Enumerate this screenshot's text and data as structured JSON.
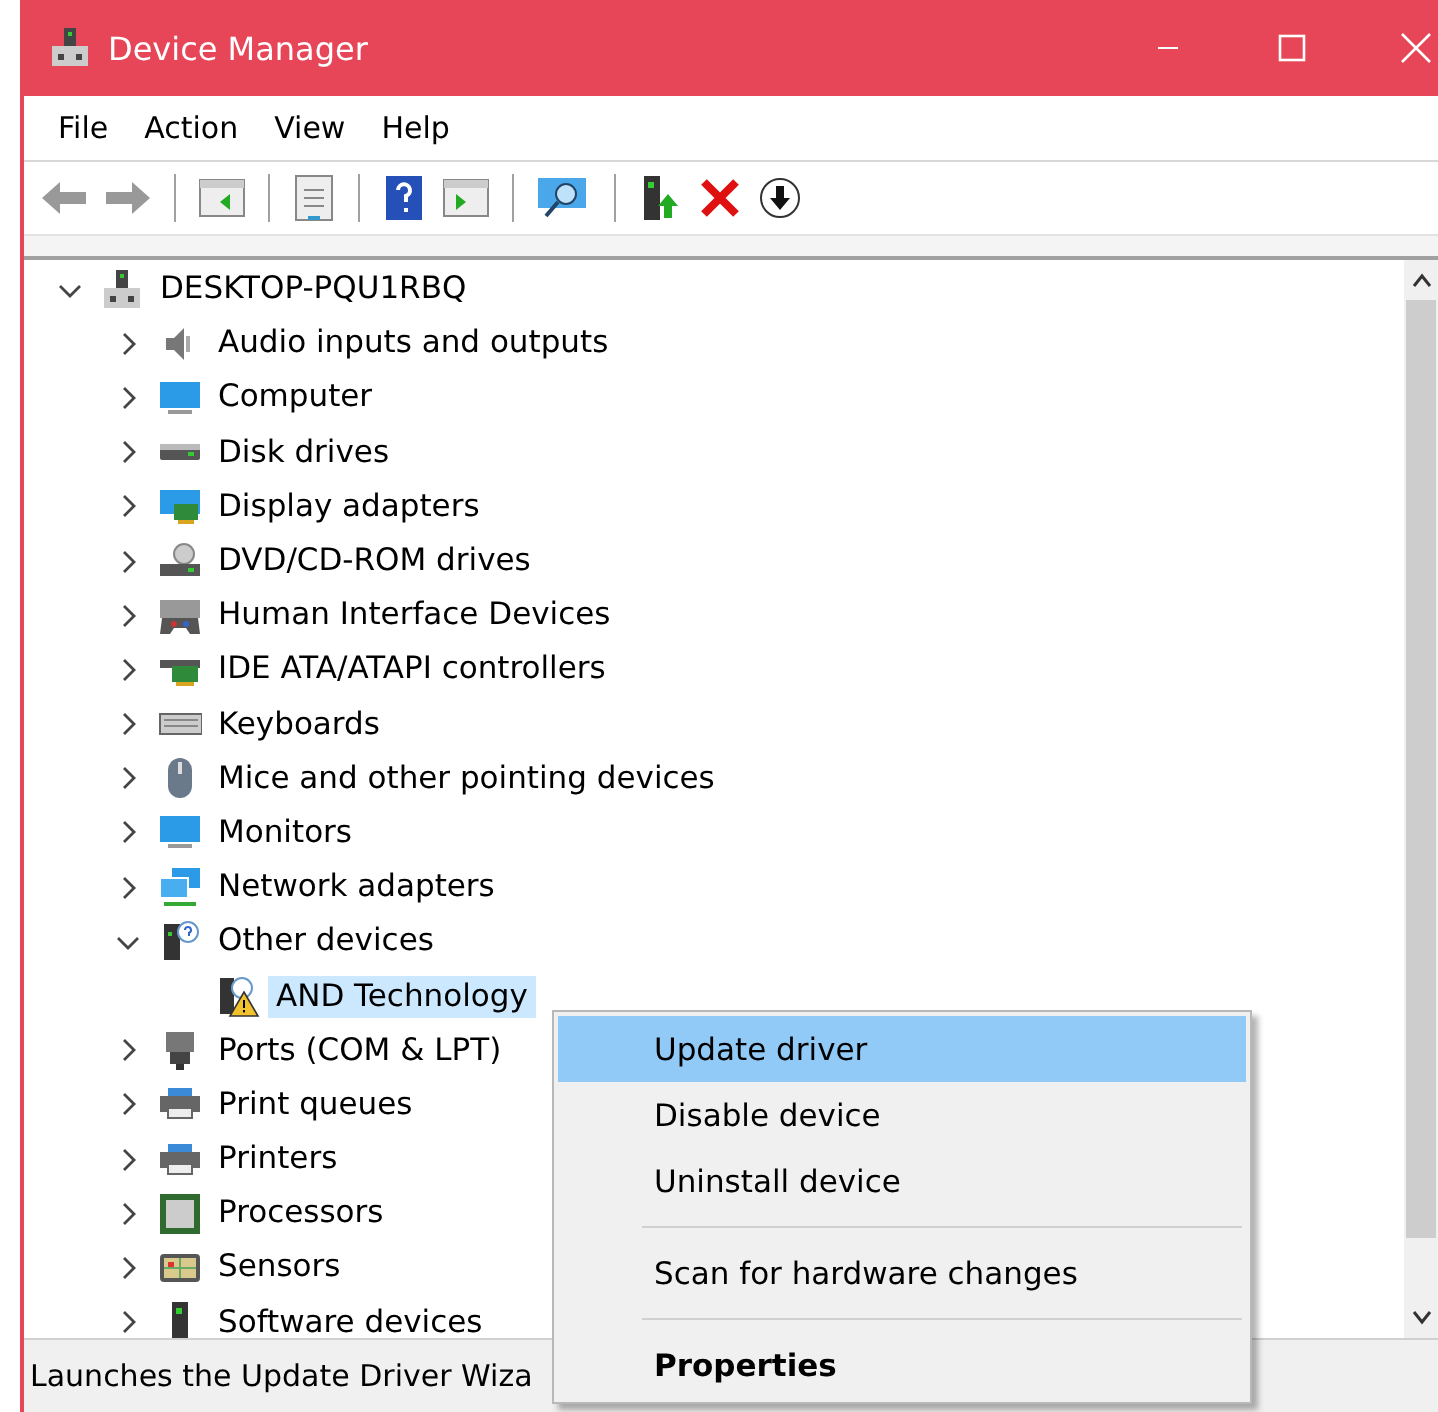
{
  "window": {
    "title": "Device Manager"
  },
  "menu": [
    "File",
    "Action",
    "View",
    "Help"
  ],
  "tree": {
    "label": "DESKTOP-PQU1RBQ",
    "expanded": true,
    "selected": false,
    "children": [
      {
        "label": "Audio inputs and outputs",
        "expanded": false,
        "selected": false
      },
      {
        "label": "Computer",
        "expanded": false,
        "selected": false
      },
      {
        "label": "Disk drives",
        "expanded": false,
        "selected": false
      },
      {
        "label": "Display adapters",
        "expanded": false,
        "selected": false
      },
      {
        "label": "DVD/CD-ROM drives",
        "expanded": false,
        "selected": false
      },
      {
        "label": "Human Interface Devices",
        "expanded": false,
        "selected": false
      },
      {
        "label": "IDE ATA/ATAPI controllers",
        "expanded": false,
        "selected": false
      },
      {
        "label": "Keyboards",
        "expanded": false,
        "selected": false
      },
      {
        "label": "Mice and other pointing devices",
        "expanded": false,
        "selected": false
      },
      {
        "label": "Monitors",
        "expanded": false,
        "selected": false
      },
      {
        "label": "Network adapters",
        "expanded": false,
        "selected": false
      },
      {
        "label": "Other devices",
        "expanded": true,
        "selected": false,
        "children": [
          {
            "label": "AND Technology",
            "selected": true
          }
        ]
      },
      {
        "label": "Ports (COM & LPT)",
        "expanded": false,
        "selected": false
      },
      {
        "label": "Print queues",
        "expanded": false,
        "selected": false
      },
      {
        "label": "Printers",
        "expanded": false,
        "selected": false
      },
      {
        "label": "Processors",
        "expanded": false,
        "selected": false
      },
      {
        "label": "Sensors",
        "expanded": false,
        "selected": false
      },
      {
        "label": "Software devices",
        "expanded": false,
        "selected": false
      }
    ]
  },
  "context_menu": [
    {
      "kind": "item",
      "label": "Update driver",
      "selected": true,
      "default": false
    },
    {
      "kind": "item",
      "label": "Disable device",
      "selected": false,
      "default": false
    },
    {
      "kind": "item",
      "label": "Uninstall device",
      "selected": false,
      "default": false
    },
    {
      "kind": "separator"
    },
    {
      "kind": "item",
      "label": "Scan for hardware changes",
      "selected": false,
      "default": false
    },
    {
      "kind": "separator"
    },
    {
      "kind": "item",
      "label": "Properties",
      "selected": false,
      "default": true
    }
  ],
  "status_bar": "Launches the Update Driver Wiza"
}
